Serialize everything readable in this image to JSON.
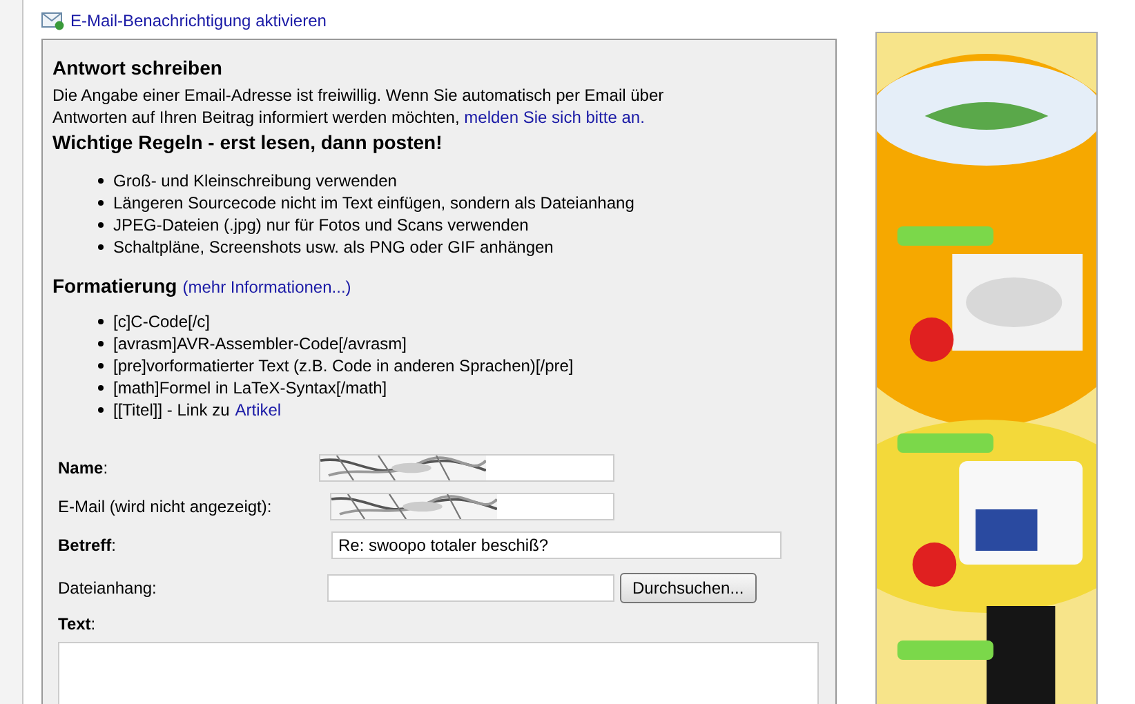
{
  "notify_link": "E-Mail-Benachrichtigung aktivieren",
  "form": {
    "title": "Antwort schreiben",
    "intro": "Die Angabe einer Email-Adresse ist freiwillig. Wenn Sie automatisch per Email über Antworten auf Ihren Beitrag informiert werden möchten,",
    "intro_link": "melden Sie sich bitte an.",
    "rules_title": "Wichtige Regeln - erst lesen, dann posten!",
    "rules": [
      "Groß- und Kleinschreibung verwenden",
      "Längeren Sourcecode nicht im Text einfügen, sondern als Dateianhang",
      "JPEG-Dateien (.jpg) nur für Fotos und Scans verwenden",
      "Schaltpläne, Screenshots usw. als PNG oder GIF anhängen"
    ],
    "format_title": "Formatierung",
    "format_link": "(mehr Informationen...)",
    "format_items": [
      {
        "text": "[c]C-Code[/c]"
      },
      {
        "text": "[avrasm]AVR-Assembler-Code[/avrasm]"
      },
      {
        "text": "[pre]vorformatierter Text (z.B. Code in anderen Sprachen)[/pre]"
      },
      {
        "text": "[math]Formel in LaTeX-Syntax[/math]"
      },
      {
        "text": "[[Titel]] - Link zu",
        "link": "Artikel"
      }
    ],
    "fields": [
      {
        "kind": "text",
        "label": "**Name**:",
        "redacted": true
      },
      {
        "kind": "text",
        "label": "E-Mail (wird nicht angezeigt):",
        "redacted": true
      },
      {
        "kind": "wide",
        "label": "**Betreff**:",
        "value": "Re: swoopo totaler beschiß?"
      },
      {
        "kind": "file",
        "label": "Dateianhang:",
        "button": "Durchsuchen..."
      }
    ],
    "text_label": "**Text**:"
  }
}
